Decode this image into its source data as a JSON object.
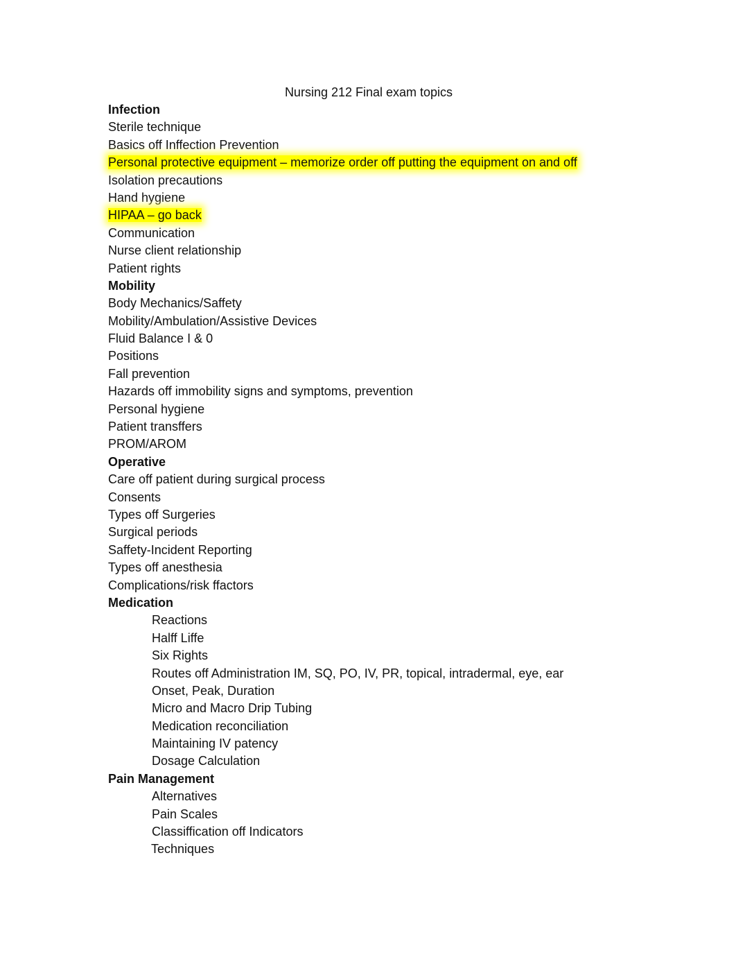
{
  "document": {
    "title": "Nursing 212 Final exam topics",
    "highlight_color": "#ffff00",
    "sections": [
      {
        "heading": "Infection",
        "items": [
          {
            "text": "Sterile technique"
          },
          {
            "text": "Basics off Inffection Prevention"
          },
          {
            "text": "Personal protective equipment – memorize order off putting the equipment on and off",
            "highlighted": true
          },
          {
            "text": "Isolation precautions"
          },
          {
            "text": "Hand hygiene"
          },
          {
            "text": "HIPAA – go back",
            "highlighted": true
          },
          {
            "text": "Communication"
          },
          {
            "text": "Nurse client relationship"
          },
          {
            "text": "Patient rights"
          }
        ]
      },
      {
        "heading": "Mobility",
        "items": [
          {
            "text": "Body Mechanics/Saffety"
          },
          {
            "text": "Mobility/Ambulation/Assistive Devices"
          },
          {
            "text": "Fluid Balance I & 0"
          },
          {
            "text": "Positions"
          },
          {
            "text": "Fall prevention"
          },
          {
            "text": "Hazards off immobility signs and symptoms, prevention"
          },
          {
            "text": "Personal hygiene"
          },
          {
            "text": "Patient transffers"
          },
          {
            "text": "PROM/AROM"
          }
        ]
      },
      {
        "heading": "Operative",
        "items": [
          {
            "text": "Care off patient during surgical process"
          },
          {
            "text": "Consents"
          },
          {
            "text": "Types off Surgeries"
          },
          {
            "text": "Surgical periods"
          },
          {
            "text": "Saffety-Incident Reporting"
          },
          {
            "text": "Types off anesthesia"
          },
          {
            "text": "Complications/risk ffactors"
          }
        ]
      },
      {
        "heading": "Medication",
        "indented": true,
        "items": [
          {
            "text": "Reactions"
          },
          {
            "text": "Halff Liffe"
          },
          {
            "text": "Six Rights"
          },
          {
            "text": "Routes off Administration IM, SQ, PO, IV, PR, topical, intradermal, eye, ear"
          },
          {
            "text": "Onset, Peak, Duration"
          },
          {
            "text": "Micro and Macro Drip Tubing"
          },
          {
            "text": "Medication reconciliation"
          },
          {
            "text": "Maintaining IV patency"
          },
          {
            "text": "Dosage Calculation"
          }
        ]
      },
      {
        "heading": "Pain Management",
        "indented": true,
        "items": [
          {
            "text": "Alternatives"
          },
          {
            "text": "Pain Scales"
          },
          {
            "text": "Classiffication off Indicators"
          },
          {
            "text": "Techniques"
          }
        ]
      }
    ]
  }
}
